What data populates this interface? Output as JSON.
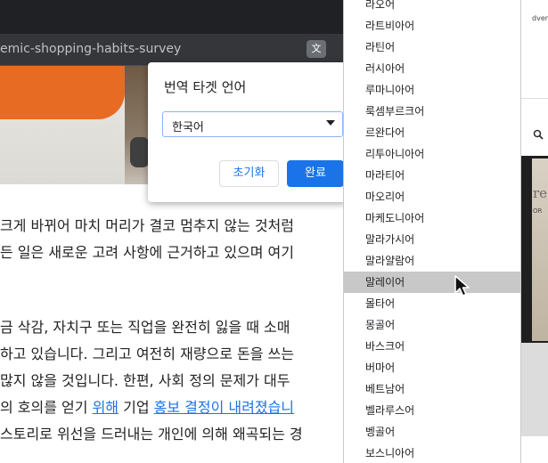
{
  "browser": {
    "url_fragment": "emic-shopping-habits-survey",
    "translate_icon": "translate-icon"
  },
  "article": {
    "lines": [
      "크게 바뀌어 마치 머리가 결코 멈추지 않는 것처럼",
      "든 일은 새로운 고려 사항에 근거하고 있으며 여기",
      "금 삭감, 자치구 또는 직업을 완전히 잃을 때 소매",
      "하고 있습니다. 그리고 여전히 재량으로 돈을 쓰는",
      "많지 않을 것입니다. 한편, 사회 정의 문제가 대두",
      "스토리로 위선을 드러내는 개인에 의해 왜곡되는 경"
    ],
    "link_line": {
      "prefix": "의 호의를 얻기 ",
      "link1": "위해",
      "middle": " 기업 ",
      "link2": "홍보 결정이 내려졌습니"
    }
  },
  "sidebar_right": {
    "ad_label": "dvertising",
    "image_text": "re",
    "image_subtext": "OR"
  },
  "dialog": {
    "title": "번역 타겟 언어",
    "selected_language": "한국어",
    "reset_label": "초기화",
    "done_label": "완료"
  },
  "dropdown": {
    "items": [
      "라오어",
      "라트비아어",
      "라틴어",
      "러시아어",
      "루마니아어",
      "룩셈부르크어",
      "르완다어",
      "리투아니아어",
      "마라티어",
      "마오리어",
      "마케도니아어",
      "말라가시어",
      "말라얄람어",
      "말레이어",
      "몰타어",
      "몽골어",
      "바스크어",
      "버마어",
      "베트남어",
      "벨라루스어",
      "벵골어",
      "보스니아어"
    ],
    "selected_index": 13
  },
  "colors": {
    "accent": "#1a73e8",
    "selected_bg": "#c8c8c8",
    "browser_dark": "#35363a"
  }
}
